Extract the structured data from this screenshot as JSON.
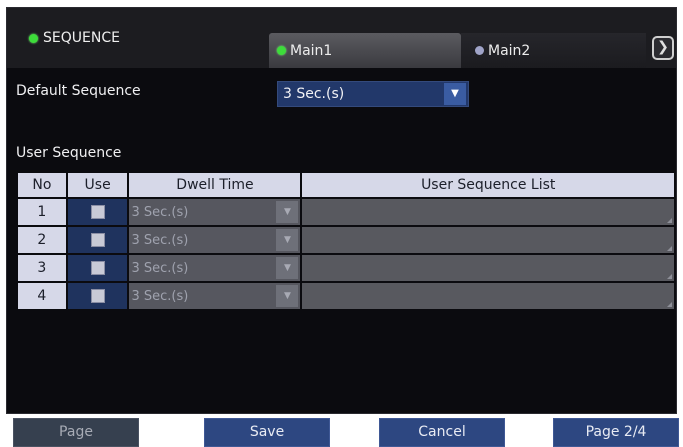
{
  "header": {
    "title": "SEQUENCE",
    "tabs": [
      {
        "label": "Main1",
        "active": true,
        "dot_color": "#3ddc3a"
      },
      {
        "label": "Main2",
        "active": false,
        "dot_color": "#a0a4c8"
      }
    ],
    "next_icon": "chevron-right-icon"
  },
  "default_sequence": {
    "label": "Default Sequence",
    "value": "3 Sec.(s)"
  },
  "user_sequence": {
    "label": "User Sequence",
    "columns": [
      "No",
      "Use",
      "Dwell Time",
      "User Sequence List"
    ],
    "rows": [
      {
        "no": "1",
        "use": false,
        "dwell": "3 Sec.(s)",
        "list": ""
      },
      {
        "no": "2",
        "use": false,
        "dwell": "3 Sec.(s)",
        "list": ""
      },
      {
        "no": "3",
        "use": false,
        "dwell": "3 Sec.(s)",
        "list": ""
      },
      {
        "no": "4",
        "use": false,
        "dwell": "3 Sec.(s)",
        "list": ""
      }
    ]
  },
  "buttons": {
    "page": "Page",
    "save": "Save",
    "cancel": "Cancel",
    "page_nav": "Page 2/4"
  },
  "colors": {
    "accent": "#2d4781",
    "active_dot": "#3ddc3a",
    "header_cell": "#d6d8e8"
  }
}
